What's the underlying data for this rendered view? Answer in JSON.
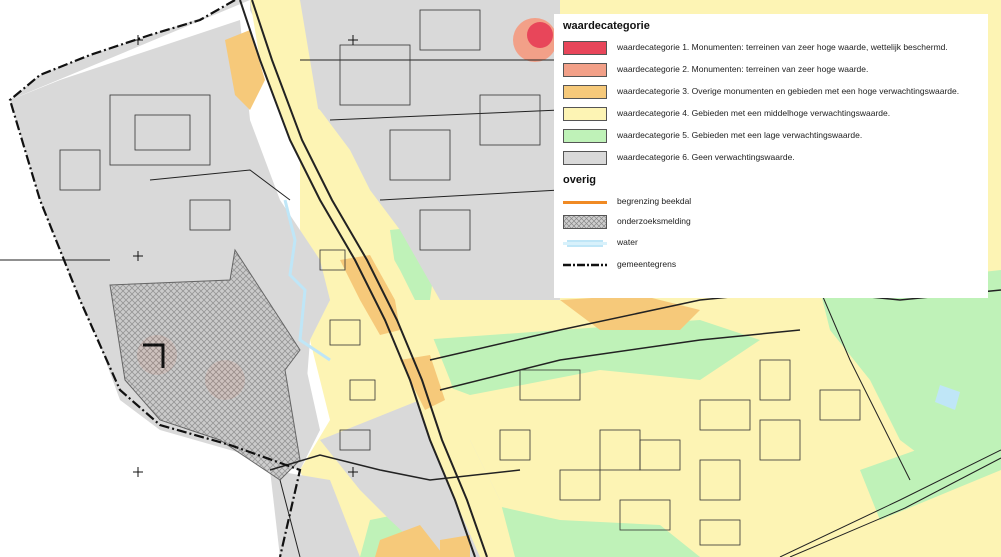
{
  "legend": {
    "section_value": "waardecategorie",
    "section_other": "overig",
    "value_items": [
      {
        "label": "waardecategorie 1. Monumenten: terreinen van zeer hoge waarde, wettelijk beschermd.",
        "color": "#e8465a"
      },
      {
        "label": "waardecategorie 2. Monumenten: terreinen van zeer hoge waarde.",
        "color": "#f2a088"
      },
      {
        "label": "waardecategorie 3. Overige monumenten en gebieden met een hoge verwachtingswaarde.",
        "color": "#f6c97a"
      },
      {
        "label": "waardecategorie 4. Gebieden met een middelhoge verwachtingswaarde.",
        "color": "#fdf4b4"
      },
      {
        "label": "waardecategorie 5. Gebieden met een lage verwachtingswaarde.",
        "color": "#bff2b8"
      },
      {
        "label": "waardecategorie 6. Geen verwachtingswaarde.",
        "color": "#d9d9d9"
      }
    ],
    "other_items": [
      {
        "label": "begrenzing beekdal",
        "symbol": "orange-line",
        "color": "#f08a24"
      },
      {
        "label": "onderzoeksmelding",
        "symbol": "crosshatch",
        "color": "#999999"
      },
      {
        "label": "water",
        "symbol": "water-line",
        "color": "#bfe6f7"
      },
      {
        "label": "gemeentegrens",
        "symbol": "dash-dot-line",
        "color": "#111111"
      }
    ]
  },
  "map": {
    "colors": {
      "outside": "#ffffff",
      "grey_zone": "#d9d9d9",
      "yellow_zone": "#fdf4b4",
      "green_zone": "#bff2b8",
      "orange_zone": "#f6c97a",
      "salmon_zone": "#f2a088",
      "red_zone": "#e8465a",
      "water": "#bfe6f7",
      "roads": "#222222"
    }
  }
}
